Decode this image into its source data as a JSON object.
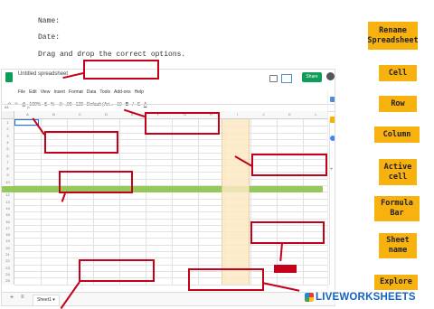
{
  "worksheet": {
    "name_label": "Name:",
    "date_label": "Date:",
    "instruction": "Drag and drop the correct options."
  },
  "sheets": {
    "doc_title": "Untitled spreadsheet",
    "menu": [
      "File",
      "Edit",
      "View",
      "Insert",
      "Format",
      "Data",
      "Tools",
      "Add-ons",
      "Help"
    ],
    "toolbar": [
      "100%",
      "$",
      "%",
      ".0",
      ".00",
      "123",
      "Default (Ari...",
      "10",
      "B",
      "I",
      "S",
      "A"
    ],
    "share_label": "Share",
    "cell_ref": "A1",
    "formula_label": "fx",
    "columns": [
      "A",
      "B",
      "C",
      "D",
      "E",
      "F",
      "G",
      "H",
      "I",
      "J",
      "K",
      "L"
    ],
    "rows": [
      "1",
      "2",
      "3",
      "4",
      "5",
      "6",
      "7",
      "8",
      "9",
      "10",
      "11",
      "12",
      "13",
      "14",
      "15",
      "16",
      "17",
      "18",
      "19",
      "20",
      "21",
      "22",
      "23",
      "24",
      "25"
    ],
    "sheet_tab": "Sheet1",
    "add_sheet": "+",
    "all_sheets": "≡",
    "highlight_colors": {
      "row": "#8bc34a",
      "column": "#fde9c4",
      "accent": "#c4001a",
      "share": "#0f9d58"
    }
  },
  "options": [
    "Rename Spreadsheet",
    "Cell",
    "Row",
    "Column",
    "Active cell",
    "Formula Bar",
    "Sheet name",
    "Explore"
  ],
  "brand": {
    "logo_text": "LIVEWORKSHEETS"
  }
}
